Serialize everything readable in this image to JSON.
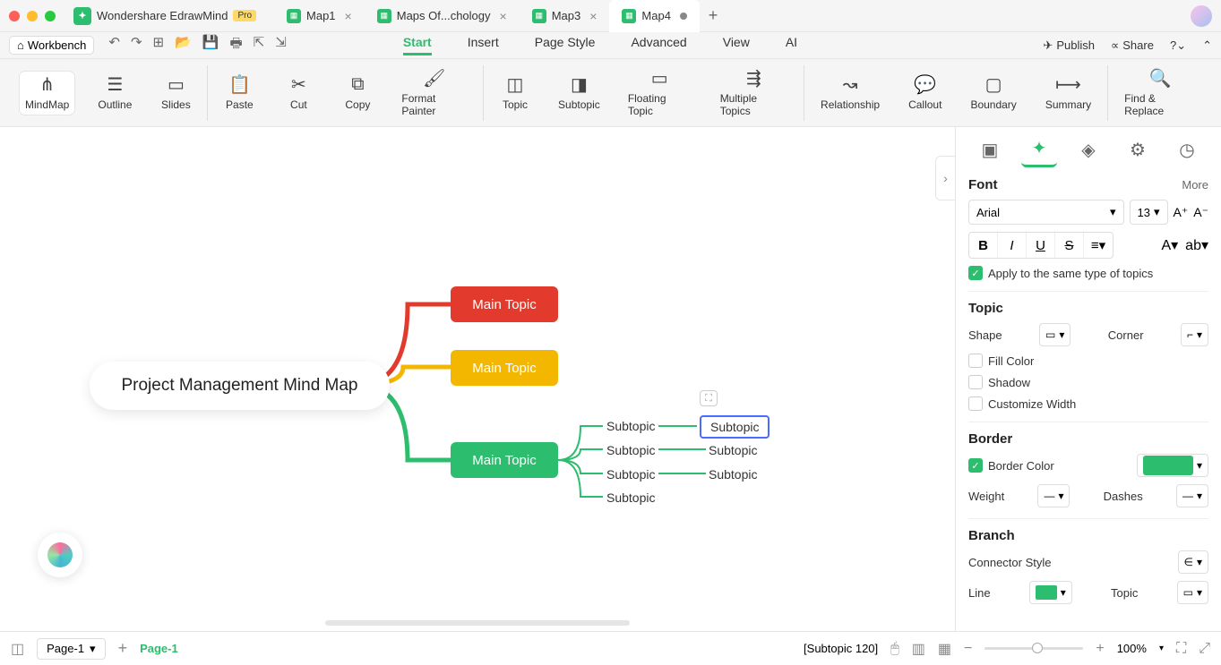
{
  "app": {
    "name": "Wondershare EdrawMind",
    "badge": "Pro"
  },
  "tabs": [
    "Map1",
    "Maps Of...chology",
    "Map3",
    "Map4"
  ],
  "activeTab": 3,
  "workbench": "Workbench",
  "menuTabs": [
    "Start",
    "Insert",
    "Page Style",
    "Advanced",
    "View",
    "AI"
  ],
  "activeMenu": 0,
  "topActions": {
    "publish": "Publish",
    "share": "Share"
  },
  "ribbon": {
    "view": [
      "MindMap",
      "Outline",
      "Slides"
    ],
    "clipboard": [
      "Paste",
      "Cut",
      "Copy",
      "Format Painter"
    ],
    "topics": [
      "Topic",
      "Subtopic",
      "Floating Topic",
      "Multiple Topics"
    ],
    "insert": [
      "Relationship",
      "Callout",
      "Boundary",
      "Summary"
    ],
    "find": "Find & Replace"
  },
  "mindmap": {
    "central": "Project Management Mind Map",
    "mains": [
      "Main Topic",
      "Main Topic",
      "Main Topic"
    ],
    "subs_l": [
      "Subtopic",
      "Subtopic",
      "Subtopic",
      "Subtopic"
    ],
    "subs_r": [
      "Subtopic",
      "Subtopic",
      "Subtopic"
    ]
  },
  "panel": {
    "font": {
      "title": "Font",
      "more": "More",
      "family": "Arial",
      "size": "13",
      "apply": "Apply to the same type of topics"
    },
    "topic": {
      "title": "Topic",
      "shape": "Shape",
      "corner": "Corner",
      "fill": "Fill Color",
      "shadow": "Shadow",
      "custom": "Customize Width"
    },
    "border": {
      "title": "Border",
      "color": "Border Color",
      "colorHex": "#2dbd6e",
      "weight": "Weight",
      "dashes": "Dashes"
    },
    "branch": {
      "title": "Branch",
      "connector": "Connector Style",
      "line": "Line",
      "topic": "Topic"
    }
  },
  "status": {
    "pageSel": "Page-1",
    "pageTab": "Page-1",
    "selection": "[Subtopic 120]",
    "zoom": "100%"
  }
}
